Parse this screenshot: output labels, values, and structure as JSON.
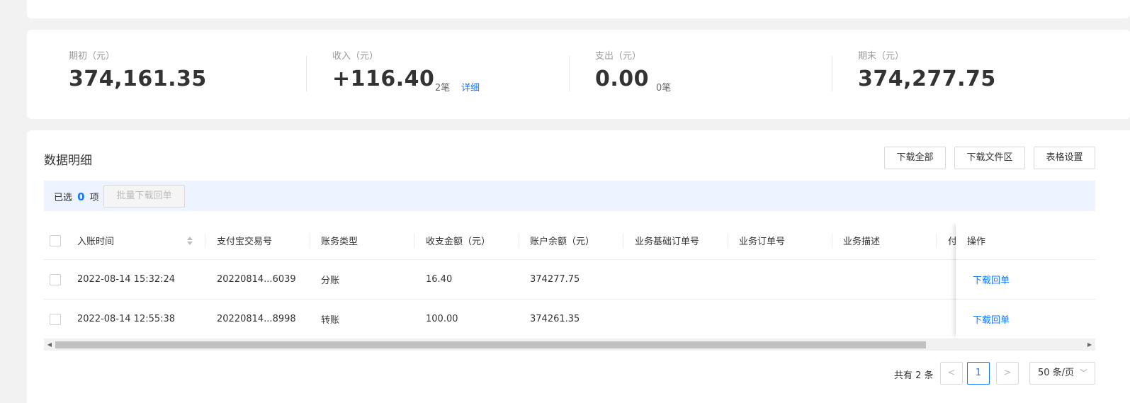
{
  "summary": {
    "opening": {
      "label": "期初（元）",
      "amount": "374,161.35"
    },
    "income": {
      "label": "收入（元）",
      "amount": "+116.40",
      "count": "2笔",
      "detail_link": "详细"
    },
    "expense": {
      "label": "支出（元）",
      "amount": "0.00",
      "count": "0笔"
    },
    "closing": {
      "label": "期末（元）",
      "amount": "374,277.75"
    }
  },
  "detail": {
    "title": "数据明细",
    "buttons": {
      "download_all": "下载全部",
      "download_area": "下载文件区",
      "table_settings": "表格设置"
    },
    "selection": {
      "prefix": "已选",
      "count": "0",
      "suffix": "项",
      "batch_button": "批量下载回单"
    }
  },
  "table": {
    "columns": {
      "time": "入账时间",
      "alipay_no": "支付宝交易号",
      "type": "账务类型",
      "amount": "收支金额（元）",
      "balance": "账户余额（元）",
      "base_order": "业务基础订单号",
      "order": "业务订单号",
      "desc": "业务描述",
      "pay_partial": "付",
      "action": "操作"
    },
    "rows": [
      {
        "time": "2022-08-14 15:32:24",
        "alipay_no": "20220814...6039",
        "type": "分账",
        "amount": "16.40",
        "balance": "374277.75",
        "action": "下载回单"
      },
      {
        "time": "2022-08-14 12:55:38",
        "alipay_no": "20220814...8998",
        "type": "转账",
        "amount": "100.00",
        "balance": "374261.35",
        "action": "下载回单"
      }
    ]
  },
  "pagination": {
    "total": "共有 2 条",
    "current_page": "1",
    "page_size": "50 条/页"
  },
  "colors": {
    "accent": "#1677ff",
    "selection_bar": "#eef4ff",
    "page_bg": "#f2f2f2"
  }
}
